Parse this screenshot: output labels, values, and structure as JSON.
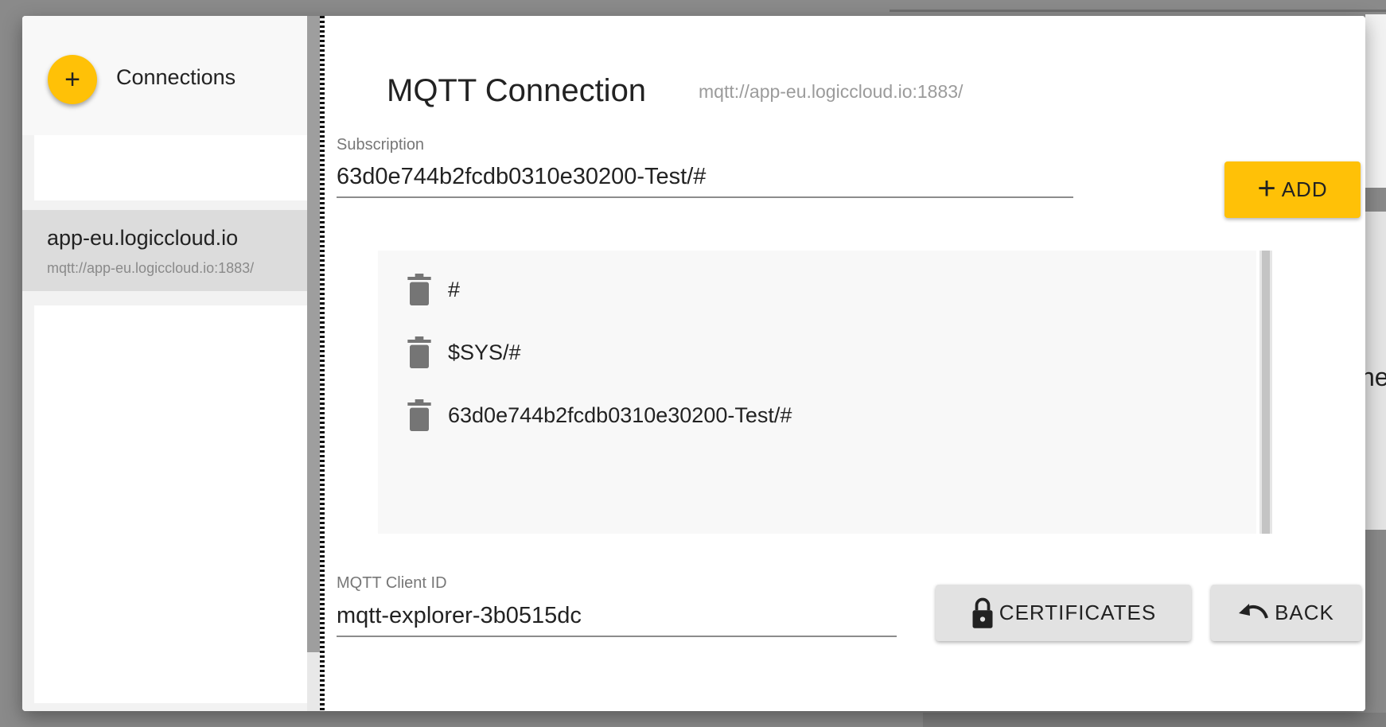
{
  "sidebar": {
    "add_label": "+",
    "title": "Connections",
    "connections": [
      {
        "name": "app-eu.logiccloud.io",
        "url": "mqtt://app-eu.logiccloud.io:1883/"
      }
    ]
  },
  "main": {
    "title": "MQTT Connection",
    "url": "mqtt://app-eu.logiccloud.io:1883/",
    "subscription": {
      "label": "Subscription",
      "value": "63d0e744b2fcdb0310e30200-Test/#"
    },
    "add_button": "ADD",
    "subscriptions": [
      {
        "topic": "#"
      },
      {
        "topic": "$SYS/#"
      },
      {
        "topic": "63d0e744b2fcdb0310e30200-Test/#"
      }
    ],
    "client_id": {
      "label": "MQTT Client ID",
      "value": "mqtt-explorer-3b0515dc"
    },
    "certificates_button": "CERTIFICATES",
    "back_button": "BACK"
  },
  "background": {
    "partial_text": "ne"
  },
  "colors": {
    "accent": "#ffc107",
    "button_grey": "#e2e2e2",
    "selected_item": "#dcdcdc"
  },
  "icons": [
    "plus-icon",
    "trash-icon",
    "lock-icon",
    "undo-icon"
  ]
}
